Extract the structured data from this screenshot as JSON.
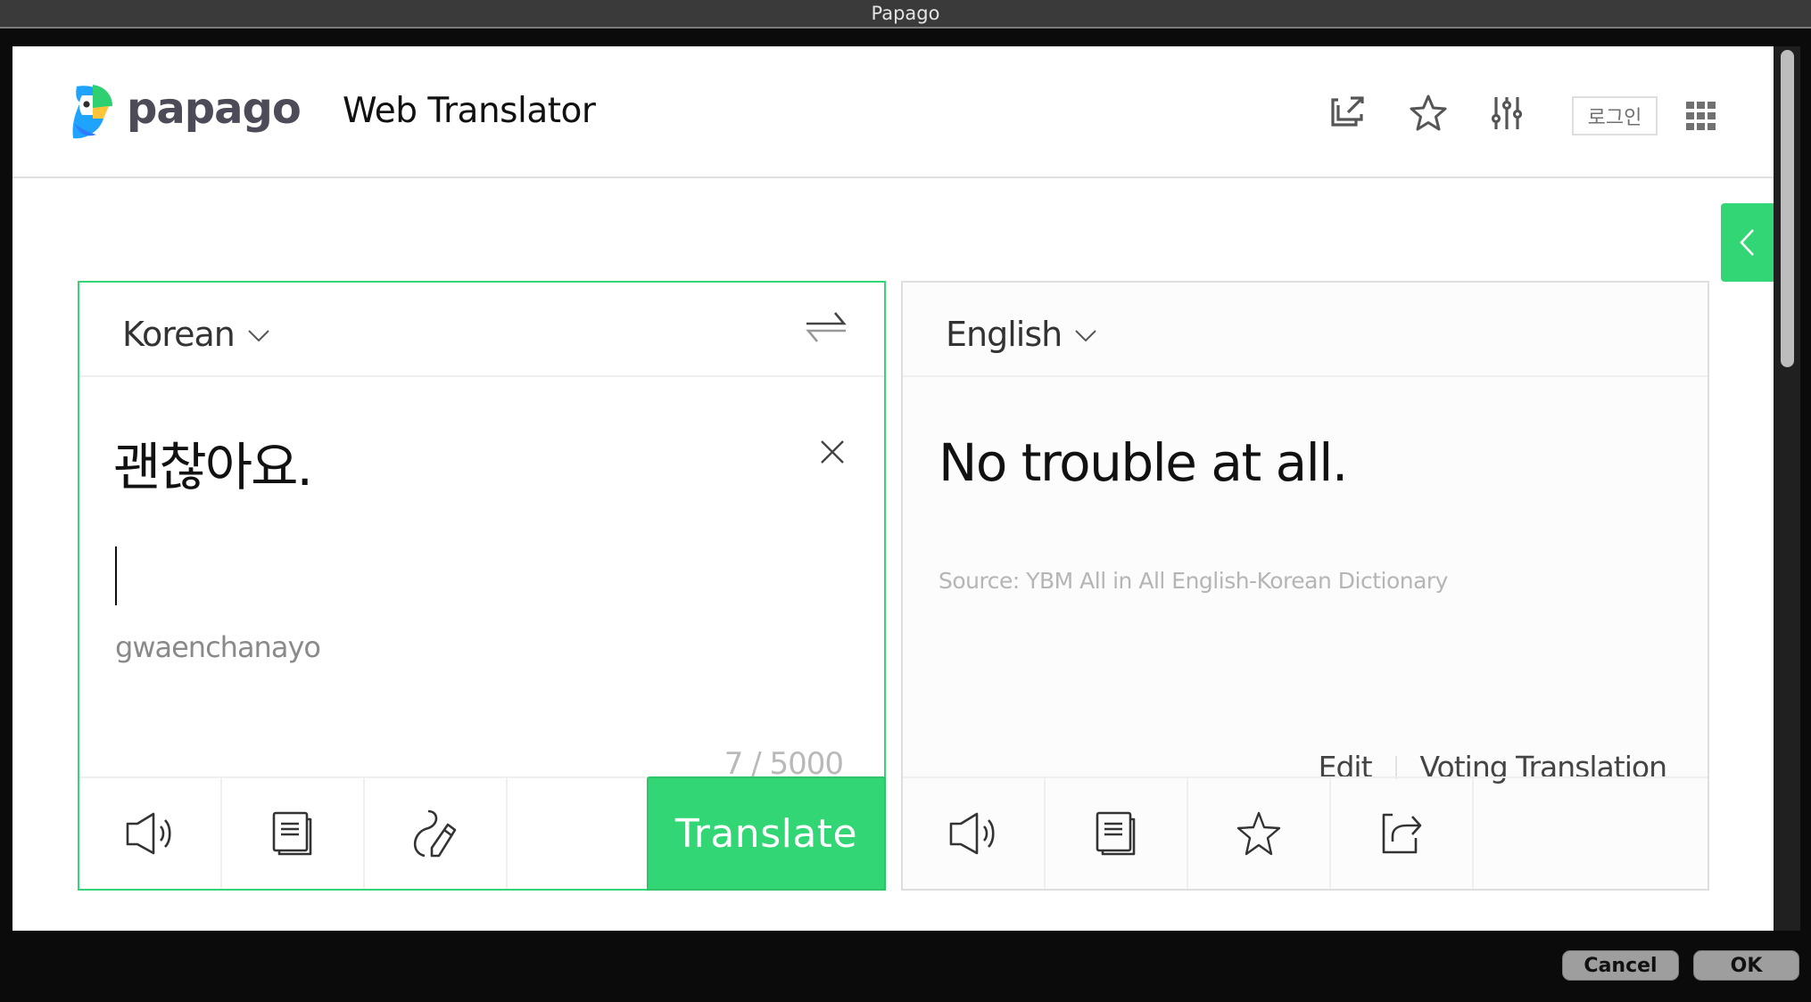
{
  "window": {
    "title": "Papago"
  },
  "header": {
    "logo_text": "papago",
    "product_title": "Web Translator",
    "icons": [
      "external-link-icon",
      "star-icon",
      "settings-sliders-icon",
      "apps-grid-icon"
    ],
    "login_label": "로그인"
  },
  "side_tab": {
    "icon": "chevron-left-icon"
  },
  "source_panel": {
    "language": "Korean",
    "swap_icon": "swap-arrows-icon",
    "input_text": "괜찮아요.",
    "romanization": "gwaenchanayo",
    "char_count": "7 / 5000",
    "toolbar": [
      "speaker-icon",
      "copy-icon",
      "handwriting-icon"
    ],
    "translate_label": "Translate"
  },
  "target_panel": {
    "language": "English",
    "output_text": "No trouble at all.",
    "source_note": "Source: YBM All in All English-Korean Dictionary",
    "edit_label": "Edit",
    "voting_label": "Voting Translation",
    "toolbar": [
      "speaker-icon",
      "copy-icon",
      "star-icon",
      "share-icon"
    ]
  },
  "dialog": {
    "cancel_label": "Cancel",
    "ok_label": "OK"
  },
  "colors": {
    "accent": "#33d674",
    "logo_text": "#4c4b57",
    "titlebar": "#3a3a3a"
  }
}
